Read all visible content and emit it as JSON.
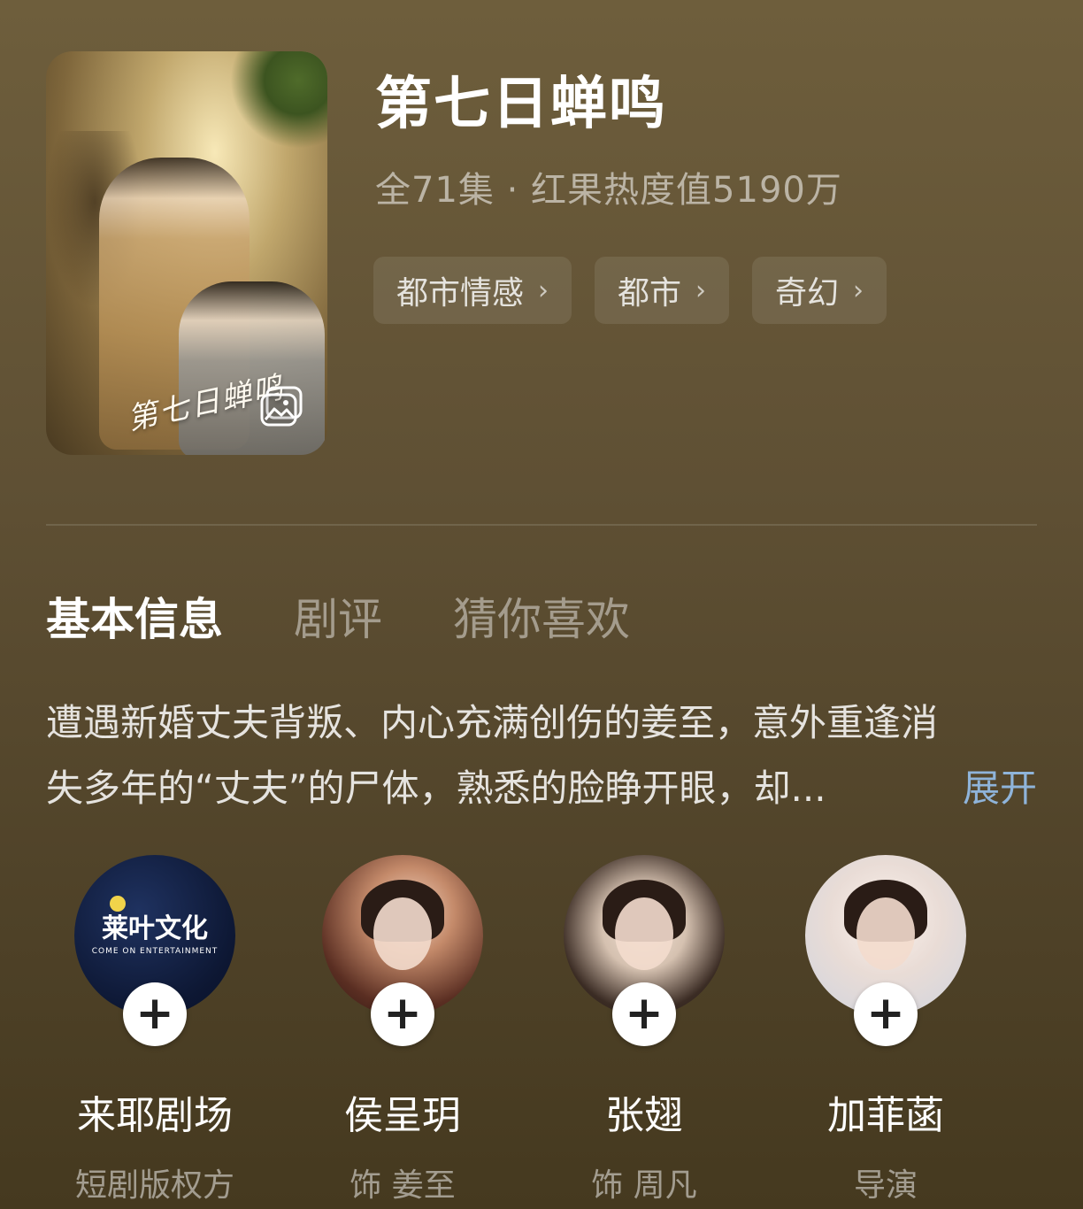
{
  "show": {
    "title": "第七日蝉鸣",
    "meta": "全71集 · 红果热度值5190万",
    "tags": [
      "都市情感",
      "都市",
      "奇幻"
    ],
    "poster_calligraphy": "第七日蝉鸣"
  },
  "tabs": [
    {
      "label": "基本信息",
      "active": true
    },
    {
      "label": "剧评",
      "active": false
    },
    {
      "label": "猜你喜欢",
      "active": false
    }
  ],
  "synopsis": {
    "line1": "遭遇新婚丈夫背叛、内心充满创伤的姜至，意外重逢消",
    "line2": "失多年的“丈夫”的尸体，熟悉的脸睁开眼，却...",
    "expand_label": "展开"
  },
  "people": [
    {
      "name": "来耶剧场",
      "role": "短剧版权方",
      "logo_text": "莱叶文化",
      "logo_sub": "COME ON ENTERTAINMENT"
    },
    {
      "name": "侯呈玥",
      "role": "饰 姜至"
    },
    {
      "name": "张翅",
      "role": "饰 周凡"
    },
    {
      "name": "加菲菡",
      "role": "导演"
    }
  ],
  "colors": {
    "background": "#5f5034",
    "expand_link": "#8fb4da"
  },
  "icons": {
    "tag_chevron": "chevron-right-icon",
    "poster_gallery": "gallery-icon",
    "follow": "plus-icon"
  }
}
